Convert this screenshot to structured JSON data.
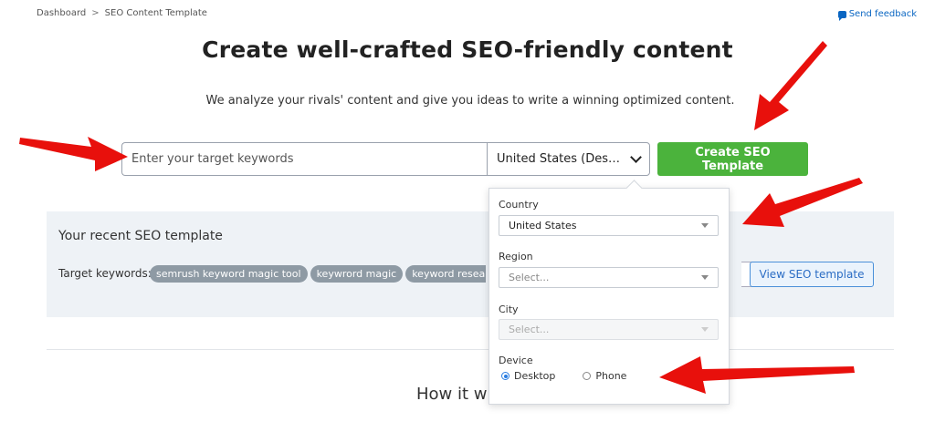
{
  "breadcrumb": {
    "items": [
      "Dashboard",
      "SEO Content Template"
    ],
    "separator": ">"
  },
  "feedback": {
    "label": "Send feedback",
    "icon": "chat-bubble-icon"
  },
  "hero": {
    "title": "Create well-crafted SEO-friendly content",
    "subtitle": "We analyze your rivals' content and give you ideas to write a winning optimized content."
  },
  "search": {
    "placeholder": "Enter your target keywords",
    "value": "",
    "country_value": "United States (Des…",
    "button_label": "Create SEO Template"
  },
  "recent": {
    "title": "Your recent SEO template",
    "target_label": "Target keywords:",
    "tags": [
      "semrush keyword magic tool",
      "keywrord magic",
      "keyword resea"
    ],
    "view_button": "View SEO template"
  },
  "how": {
    "title": "How it w"
  },
  "dropdown": {
    "country": {
      "label": "Country",
      "value": "United States"
    },
    "region": {
      "label": "Region",
      "placeholder": "Select..."
    },
    "city": {
      "label": "City",
      "placeholder": "Select..."
    },
    "device": {
      "label": "Device",
      "options": [
        "Desktop",
        "Phone"
      ],
      "selected": "Desktop"
    }
  },
  "colors": {
    "accent_green": "#4bb33c",
    "link_blue": "#0a66c2",
    "annotation_red": "#e8100c",
    "panel_bg": "#eef2f6"
  }
}
